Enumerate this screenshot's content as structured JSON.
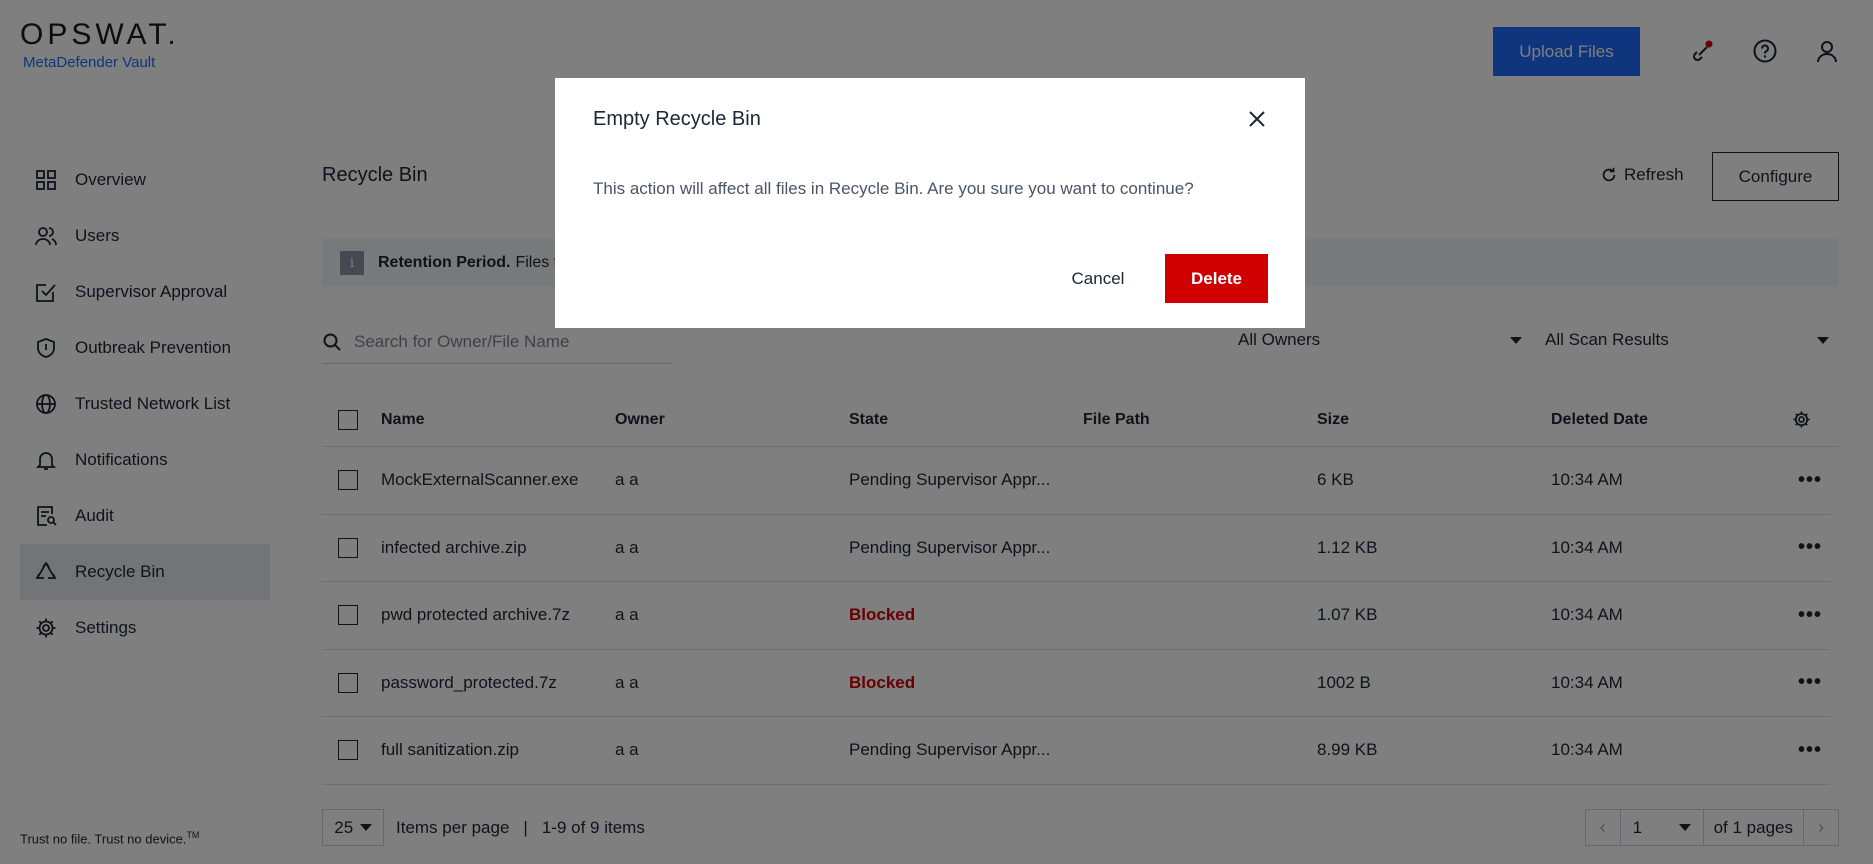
{
  "brand": {
    "logo": "OPSWAT.",
    "product": "MetaDefender Vault"
  },
  "header": {
    "upload_label": "Upload Files"
  },
  "sidebar": {
    "items": [
      {
        "label": "Overview",
        "icon": "grid-icon"
      },
      {
        "label": "Users",
        "icon": "users-icon"
      },
      {
        "label": "Supervisor Approval",
        "icon": "approval-icon"
      },
      {
        "label": "Outbreak Prevention",
        "icon": "shield-icon"
      },
      {
        "label": "Trusted Network List",
        "icon": "globe-icon"
      },
      {
        "label": "Notifications",
        "icon": "bell-icon"
      },
      {
        "label": "Audit",
        "icon": "audit-icon"
      },
      {
        "label": "Recycle Bin",
        "icon": "recycle-icon"
      },
      {
        "label": "Settings",
        "icon": "gear-icon"
      }
    ],
    "active": "Recycle Bin",
    "footer": "Trust no file. Trust no device.",
    "footer_mark": "TM"
  },
  "main": {
    "title": "Recycle Bin",
    "refresh_label": "Refresh",
    "configure_label": "Configure",
    "retention_bold": "Retention Period.",
    "retention_text": "Files t",
    "search_placeholder": "Search for Owner/File Name",
    "owners_filter": "All Owners",
    "scan_filter": "All Scan Results"
  },
  "table": {
    "headers": {
      "name": "Name",
      "owner": "Owner",
      "state": "State",
      "path": "File Path",
      "size": "Size",
      "date": "Deleted Date"
    },
    "rows": [
      {
        "name": "MockExternalScanner.exe",
        "owner": "a a",
        "state": "Pending Supervisor Appr...",
        "path": "",
        "size": "6 KB",
        "date": "10:34 AM"
      },
      {
        "name": "infected archive.zip",
        "owner": "a a",
        "state": "Pending Supervisor Appr...",
        "path": "",
        "size": "1.12 KB",
        "date": "10:34 AM"
      },
      {
        "name": "pwd protected archive.7z",
        "owner": "a a",
        "state": "Blocked",
        "path": "",
        "size": "1.07 KB",
        "date": "10:34 AM"
      },
      {
        "name": "password_protected.7z",
        "owner": "a a",
        "state": "Blocked",
        "path": "",
        "size": "1002 B",
        "date": "10:34 AM"
      },
      {
        "name": "full sanitization.zip",
        "owner": "a a",
        "state": "Pending Supervisor Appr...",
        "path": "",
        "size": "8.99 KB",
        "date": "10:34 AM"
      }
    ]
  },
  "pager": {
    "per_page": "25",
    "per_page_label": "Items per page",
    "separator": "|",
    "range": "1-9 of 9 items",
    "page": "1",
    "of_pages": "of 1 pages"
  },
  "modal": {
    "title": "Empty Recycle Bin",
    "body": "This action will affect all files in Recycle Bin. Are you sure you want to continue?",
    "cancel_label": "Cancel",
    "delete_label": "Delete"
  },
  "colors": {
    "brand_blue": "#1d6bfc",
    "danger": "#d00000",
    "overlay": "rgba(0,0,0,0.5)"
  }
}
